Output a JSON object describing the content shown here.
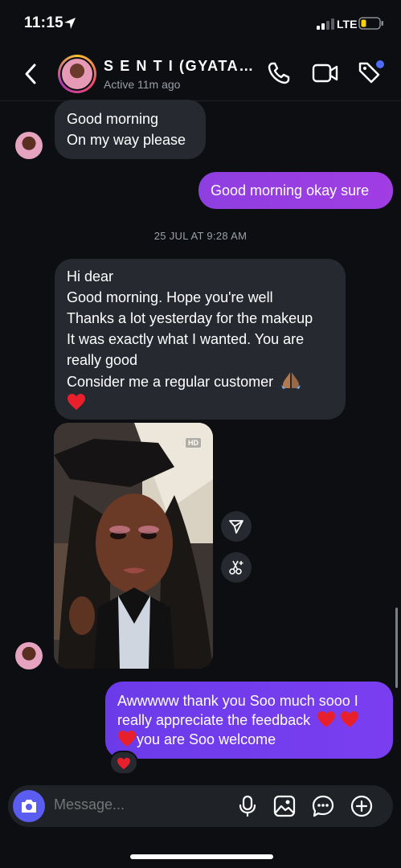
{
  "status_bar": {
    "time": "11:15",
    "network": "LTE",
    "icons": [
      "location-arrow-icon",
      "signal-icon",
      "battery-icon"
    ]
  },
  "header": {
    "contact_name": "S E N T I (GYATABA...",
    "status": "Active 11m ago",
    "icons": [
      "back-chevron-icon",
      "phone-icon",
      "video-camera-icon",
      "tag-icon"
    ]
  },
  "messages": {
    "m1": {
      "lines": [
        "Good morning",
        "On my way please"
      ]
    },
    "m2": {
      "text": "Good morning okay sure"
    },
    "timestamp": "25 JUL AT 9:28 AM",
    "m3": {
      "lines": [
        "Hi dear",
        "Good morning. Hope you're well",
        "Thanks a lot yesterday for the makeup",
        "It was exactly what I wanted. You are",
        "really good",
        "Consider me a regular customer",
        ""
      ]
    },
    "photo": {
      "badge": "HD"
    },
    "m4": {
      "lines": [
        "Awwwww thank you Soo much sooo I",
        "really appreciate the feedback",
        "you are Soo welcome"
      ]
    },
    "reaction": "red-heart"
  },
  "composer": {
    "placeholder": "Message...",
    "icons": [
      "camera-icon",
      "microphone-icon",
      "gallery-icon",
      "sticker-icon",
      "plus-icon"
    ]
  },
  "colors": {
    "background": "#0c0e12",
    "incoming": "#26292f",
    "outgoing_purple": "#9a3ee2",
    "outgoing_blue": "#7040ee",
    "accent": "#5b5cf0"
  }
}
